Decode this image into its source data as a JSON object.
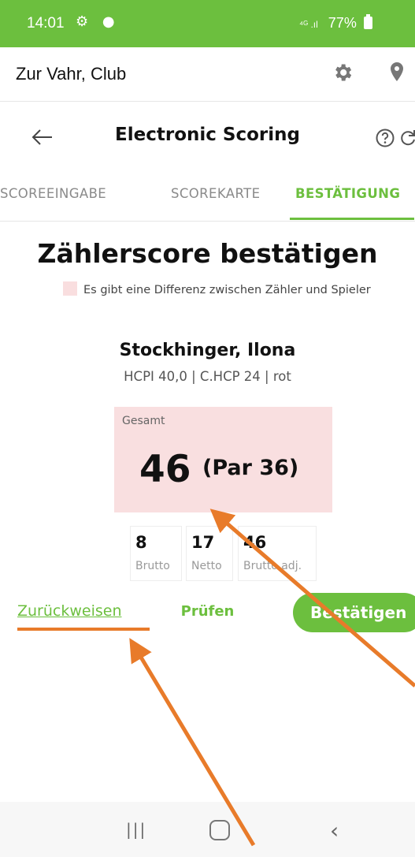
{
  "status_bar": {
    "time": "14:01",
    "notif_icons": "⚙ ●",
    "signal": "⁴ᴳ .ıl",
    "battery": "77%"
  },
  "app_bar": {
    "club_name": "Zur Vahr, Club"
  },
  "title_bar": {
    "title": "Electronic Scoring"
  },
  "tabs": [
    {
      "label": "SCOREEINGABE",
      "active": false
    },
    {
      "label": "SCOREKARTE",
      "active": false
    },
    {
      "label": "BESTÄTIGUNG",
      "active": true
    }
  ],
  "main": {
    "title": "Zählerscore bestätigen",
    "legend": "Es gibt eine Differenz zwischen Zähler und Spieler"
  },
  "player": {
    "name": "Stockhinger, Ilona",
    "hcp_line": "HCPI 40,0 | C.HCP 24 | rot"
  },
  "total": {
    "label": "Gesamt",
    "score": "46",
    "par": "(Par 36)"
  },
  "stats": [
    {
      "value": "8",
      "label": "Brutto"
    },
    {
      "value": "17",
      "label": "Netto"
    },
    {
      "value": "46",
      "label": "Brutto adj."
    }
  ],
  "actions": {
    "check": "Prüfen",
    "reject": "Zurückweisen",
    "confirm": "Bestätigen"
  },
  "nav": {
    "recent": "|||",
    "back": "‹"
  },
  "colors": {
    "accent": "#6cbf3e",
    "diff": "#f9dedf",
    "annotation": "#e87b2a"
  }
}
